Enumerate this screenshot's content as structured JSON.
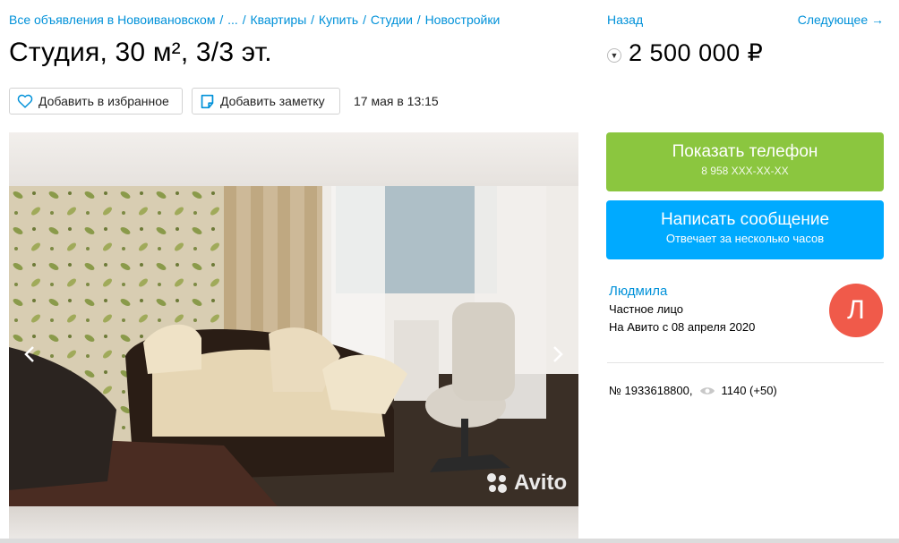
{
  "breadcrumbs": {
    "items": [
      "Все объявления в Новоивановском",
      "...",
      "Квартиры",
      "Купить",
      "Студии",
      "Новостройки"
    ],
    "separator": "/"
  },
  "nav": {
    "back": "Назад",
    "next": "Следующее →"
  },
  "title": "Студия, 30 м², 3/3 эт.",
  "price": "2 500 000 ₽",
  "actions": {
    "favorite_label": "Добавить в избранное",
    "note_label": "Добавить заметку",
    "date": "17 мая в 13:15"
  },
  "gallery": {
    "watermark": "Avito",
    "prev_icon": "chevron-left-icon",
    "next_icon": "chevron-right-icon"
  },
  "contact": {
    "phone_label": "Показать телефон",
    "phone_masked": "8 958 XXX-XX-XX",
    "message_label": "Написать сообщение",
    "message_sub": "Отвечает за несколько часов"
  },
  "seller": {
    "name": "Людмила",
    "type": "Частное лицо",
    "since": "На Авито с 08 апреля 2020",
    "avatar_letter": "Л"
  },
  "ad": {
    "number": "№ 1933618800,",
    "views": "1140 (+50)"
  },
  "colors": {
    "link": "#0091d9",
    "phone_button": "#8bc63f",
    "message_button": "#00aaff",
    "avatar": "#f05a4a"
  }
}
